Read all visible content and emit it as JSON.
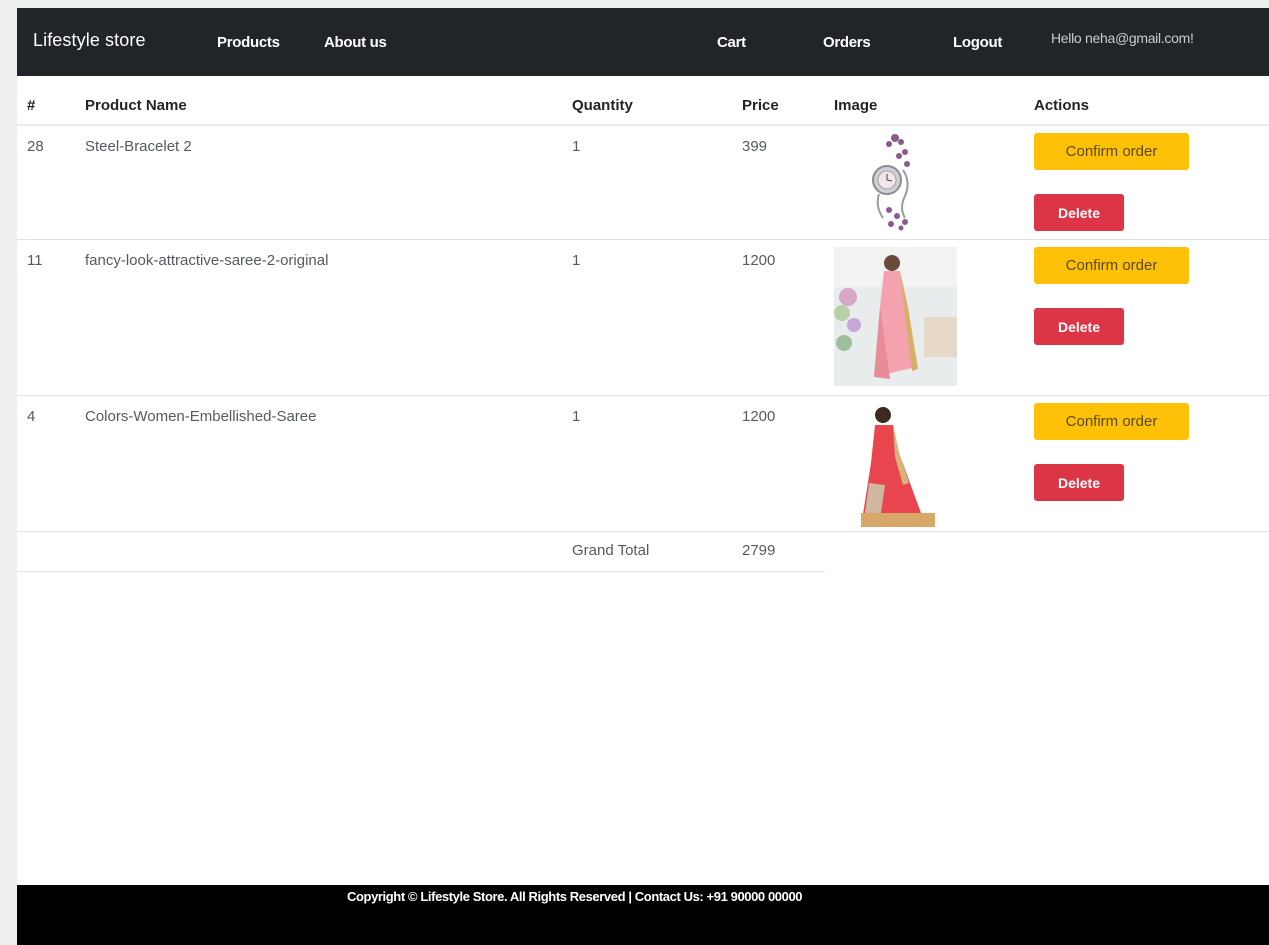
{
  "navbar": {
    "brand": "Lifestyle store",
    "links": {
      "products": "Products",
      "about": "About us",
      "cart": "Cart",
      "orders": "Orders",
      "logout": "Logout"
    },
    "greeting": "Hello neha@gmail.com!"
  },
  "table": {
    "headers": {
      "num": "#",
      "name": "Product Name",
      "quantity": "Quantity",
      "price": "Price",
      "image": "Image",
      "actions": "Actions"
    },
    "rows": [
      {
        "id": "28",
        "name": "Steel-Bracelet 2",
        "quantity": "1",
        "price": "399",
        "image": "bracelet-watch-image",
        "confirm": "Confirm order",
        "delete": "Delete"
      },
      {
        "id": "11",
        "name": "fancy-look-attractive-saree-2-original",
        "quantity": "1",
        "price": "1200",
        "image": "pink-saree-image",
        "confirm": "Confirm order",
        "delete": "Delete"
      },
      {
        "id": "4",
        "name": "Colors-Women-Embellished-Saree",
        "quantity": "1",
        "price": "1200",
        "image": "red-saree-image",
        "confirm": "Confirm order",
        "delete": "Delete"
      }
    ],
    "grand_total_label": "Grand Total",
    "grand_total_value": "2799"
  },
  "footer": {
    "copyright": "Copyright © Lifestyle Store. All Rights Reserved | Contact Us: +91 90000 00000"
  },
  "colors": {
    "navbar": "#212529",
    "confirm": "#ffc107",
    "delete": "#dc3545",
    "footer": "#000000"
  }
}
